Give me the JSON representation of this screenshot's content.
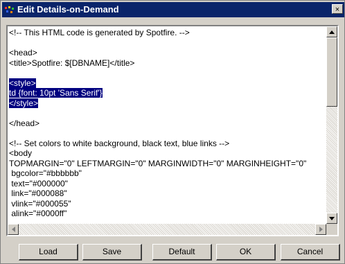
{
  "window": {
    "title": "Edit Details-on-Demand",
    "close_label": "×"
  },
  "editor": {
    "lines": [
      {
        "text": "<!-- This HTML code is generated by Spotfire. -->",
        "selected": false
      },
      {
        "text": "",
        "selected": false
      },
      {
        "text": "<head>",
        "selected": false
      },
      {
        "text": "<title>Spotfire: $[DBNAME]</title>",
        "selected": false
      },
      {
        "text": "",
        "selected": false
      },
      {
        "text": "<style>",
        "selected": true
      },
      {
        "text": "td {font: 10pt 'Sans Serif'}",
        "selected": true
      },
      {
        "text": "</style>",
        "selected": true
      },
      {
        "text": "",
        "selected": false
      },
      {
        "text": "</head>",
        "selected": false
      },
      {
        "text": "",
        "selected": false
      },
      {
        "text": "<!-- Set colors to white background, black text, blue links -->",
        "selected": false
      },
      {
        "text": "<body",
        "selected": false
      },
      {
        "text": "TOPMARGIN=\"0\" LEFTMARGIN=\"0\" MARGINWIDTH=\"0\" MARGINHEIGHT=\"0\"",
        "selected": false
      },
      {
        "text": " bgcolor=\"#bbbbbb\"",
        "selected": false
      },
      {
        "text": " text=\"#000000\"",
        "selected": false
      },
      {
        "text": " link=\"#000088\"",
        "selected": false
      },
      {
        "text": " vlink=\"#000055\"",
        "selected": false
      },
      {
        "text": " alink=\"#0000ff\"",
        "selected": false
      }
    ]
  },
  "buttons": {
    "load": "Load",
    "save": "Save",
    "default": "Default",
    "ok": "OK",
    "cancel": "Cancel"
  },
  "colors": {
    "title_bar": "#0a246a",
    "selection": "#000080",
    "face": "#d4d0c8"
  },
  "icons": {
    "app": "spotfire-app-icon",
    "close": "close-icon",
    "up": "arrow-up-icon",
    "down": "arrow-down-icon",
    "left": "arrow-left-icon",
    "right": "arrow-right-icon"
  }
}
